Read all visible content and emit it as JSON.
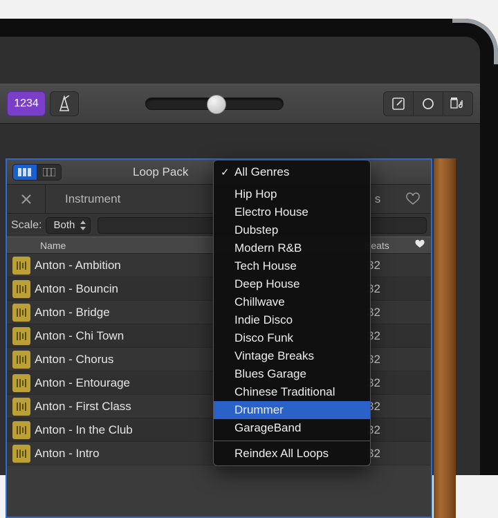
{
  "toolbar": {
    "counter": "1234"
  },
  "browser": {
    "title": "Loop Pack",
    "tab_instrument": "Instrument",
    "scale_label": "Scale:",
    "scale_value": "Both",
    "header_name": "Name",
    "header_beats": "Beats",
    "rows": [
      {
        "name": "Anton - Ambition",
        "beats": "32"
      },
      {
        "name": "Anton - Bouncin",
        "beats": "32"
      },
      {
        "name": "Anton - Bridge",
        "beats": "32"
      },
      {
        "name": "Anton - Chi Town",
        "beats": "32"
      },
      {
        "name": "Anton - Chorus",
        "beats": "32"
      },
      {
        "name": "Anton - Entourage",
        "beats": "32"
      },
      {
        "name": "Anton - First Class",
        "beats": "32"
      },
      {
        "name": "Anton - In the Club",
        "beats": "32"
      },
      {
        "name": "Anton - Intro",
        "beats": "32"
      }
    ]
  },
  "menu": {
    "items": [
      {
        "label": "All Genres",
        "checked": true
      },
      {
        "label": "Hip Hop"
      },
      {
        "label": "Electro House"
      },
      {
        "label": "Dubstep"
      },
      {
        "label": "Modern R&B"
      },
      {
        "label": "Tech House"
      },
      {
        "label": "Deep House"
      },
      {
        "label": "Chillwave"
      },
      {
        "label": "Indie Disco"
      },
      {
        "label": "Disco Funk"
      },
      {
        "label": "Vintage Breaks"
      },
      {
        "label": "Blues Garage"
      },
      {
        "label": "Chinese Traditional"
      },
      {
        "label": "Drummer",
        "selected": true
      },
      {
        "label": "GarageBand"
      }
    ],
    "footer": "Reindex All Loops"
  }
}
